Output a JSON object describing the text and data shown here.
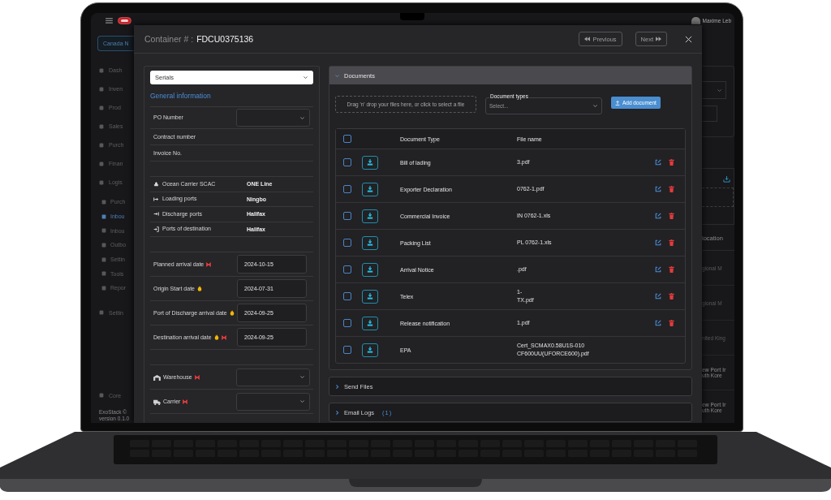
{
  "topbar": {
    "location": "Canada N",
    "user": "Maxime Leb"
  },
  "sidebar": {
    "items": [
      {
        "label": "Dash"
      },
      {
        "label": "Inven"
      },
      {
        "label": "Prod"
      },
      {
        "label": "Sales"
      },
      {
        "label": "Purch"
      },
      {
        "label": "Finan"
      },
      {
        "label": "Logis"
      }
    ],
    "subitems": [
      {
        "label": "Purch",
        "selected": false
      },
      {
        "label": "Inbou",
        "selected": true
      },
      {
        "label": "Inbou",
        "selected": false
      },
      {
        "label": "Outbo",
        "selected": false
      },
      {
        "label": "Settin",
        "selected": false
      },
      {
        "label": "Tools",
        "selected": false
      },
      {
        "label": "Repor",
        "selected": false
      }
    ],
    "settings": "Settin",
    "core": "Core",
    "footer": [
      "ExoStack ©",
      "version 0.1.0"
    ]
  },
  "background_panel": {
    "heading": "location",
    "rows": [
      {
        "lines": [
          "gional M"
        ]
      },
      {
        "lines": [
          "gional M"
        ]
      },
      {
        "lines": [
          "nited King"
        ]
      },
      {
        "lines": [
          "ew Port Ir",
          "uth Kore"
        ]
      },
      {
        "lines": [
          "ew Port Ir",
          "uth Kore"
        ]
      }
    ]
  },
  "modal": {
    "title_label": "Container # :",
    "title_value": "FDCU0375136",
    "buttons": [
      {
        "label": "Previous",
        "kind": "previous"
      },
      {
        "label": "Next",
        "kind": "next"
      }
    ],
    "left": {
      "select": "Serials",
      "heading": "General information",
      "reference_fields": [
        {
          "label": "PO Number",
          "kind": "select"
        },
        {
          "label": "Contract number",
          "kind": "text"
        },
        {
          "label": "Invoice No.",
          "kind": "text"
        }
      ],
      "shipping": [
        {
          "label": "Ocean Carrier SCAC",
          "value": "ONE Line"
        },
        {
          "label": "Loading ports",
          "value": "Ningbo"
        },
        {
          "label": "Discharge ports",
          "value": "Halifax"
        },
        {
          "label": "Ports of destination",
          "value": "Halifax"
        }
      ],
      "dates": [
        {
          "label": "Planned arrival date",
          "value": "2024-10-15",
          "markers": [
            {
              "kind": "bowtie"
            }
          ]
        },
        {
          "label": "Origin Start date",
          "value": "2024-07-31",
          "markers": [
            {
              "kind": "flame"
            }
          ]
        },
        {
          "label": "Port of Discharge arrival date",
          "value": "2024-09-25",
          "markers": [
            {
              "kind": "flame"
            }
          ]
        },
        {
          "label": "Destination arrival date",
          "value": "2024-09-25",
          "markers": [
            {
              "kind": "flame"
            },
            {
              "kind": "bowtie"
            }
          ]
        }
      ],
      "assignments": [
        {
          "label": "Warehouse",
          "markers": [
            {
              "kind": "bowtie"
            }
          ]
        },
        {
          "label": "Carrier",
          "markers": [
            {
              "kind": "bowtie"
            }
          ]
        }
      ]
    },
    "documents": {
      "title": "Documents",
      "expanded": true,
      "dropzone": "Drag 'n' drop your files here, or click to select a file",
      "type_label": "Document types",
      "type_placeholder": "Select...",
      "add_button": "Add document",
      "columns": [
        "Document Type",
        "File name"
      ],
      "all_checked": false,
      "rows": [
        {
          "type": "Bill of lading",
          "file": "3.pdf",
          "checked": false,
          "editable": true
        },
        {
          "type": "Exporter Declaration",
          "file": "0762-1.pdf",
          "checked": false,
          "editable": true
        },
        {
          "type": "Commercial Invoice",
          "file": "IN 0762-1.xls",
          "checked": false,
          "editable": true
        },
        {
          "type": "Packing List",
          "file": "PL 0762-1.xls",
          "checked": false,
          "editable": true
        },
        {
          "type": "Arrival Notice",
          "file": ".pdf",
          "checked": false,
          "editable": true
        },
        {
          "type": "Telex",
          "file": "1-\nTX.pdf",
          "checked": false,
          "editable": true
        },
        {
          "type": "Release notification",
          "file": "1.pdf",
          "checked": false,
          "editable": true
        },
        {
          "type": "EPA",
          "file": "Cert_SCMAX0.58U1S-010 CF600UU(UFORCE600).pdf",
          "checked": false,
          "editable": false
        }
      ]
    },
    "sections": [
      {
        "title": "Send Files",
        "expanded": false
      },
      {
        "title": "Email Logs",
        "count": "(1)",
        "expanded": false
      }
    ]
  }
}
